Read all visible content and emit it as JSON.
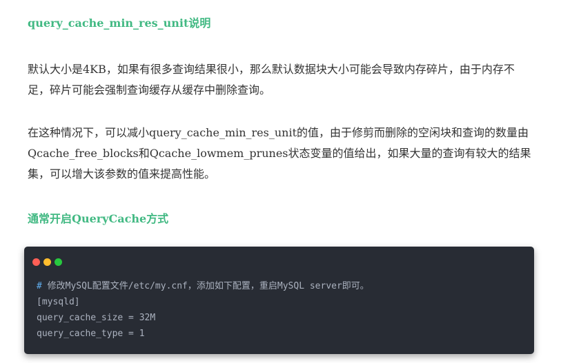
{
  "headings": {
    "query_cache_title": "query_cache_min_res_unit说明",
    "enable_title": "通常开启QueryCache方式"
  },
  "paragraphs": {
    "p1": "默认大小是4KB，如果有很多查询结果很小，那么默认数据块大小可能会导致内存碎片，由于内存不足，碎片可能会强制查询缓存从缓存中删除查询。",
    "p2": "在这种情况下，可以减小query_cache_min_res_unit的值，由于修剪而删除的空闲块和查询的数量由Qcache_free_blocks和Qcache_lowmem_prunes状态变量的值给出，如果大量的查询有较大的结果集，可以增大该参数的值来提高性能。"
  },
  "code_block": {
    "window_dots": [
      {
        "name": "close",
        "color": "#ff5f56"
      },
      {
        "name": "minimize",
        "color": "#ffbd2e"
      },
      {
        "name": "maximize",
        "color": "#27c93f"
      }
    ],
    "comment_hash": "#",
    "comment_text": " 修改MySQL配置文件/etc/my.cnf，添加如下配置，重启MySQL server即可。",
    "line_2": "[mysqld]",
    "line_3": "query_cache_size = 32M",
    "line_4": "query_cache_type = 1"
  },
  "colors": {
    "heading": "#42b983",
    "text": "#333333",
    "code_background": "#282c34",
    "code_text": "#abb2bf",
    "comment_hash": "#61aeee"
  }
}
